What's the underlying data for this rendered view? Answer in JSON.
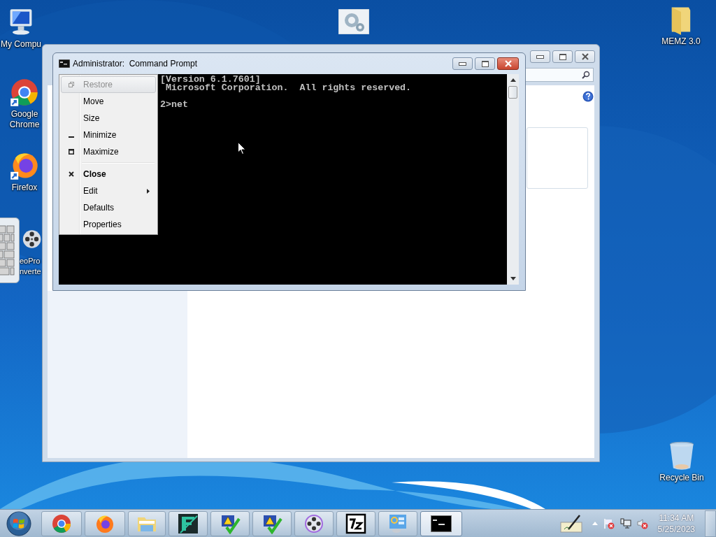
{
  "desktop_icons": [
    {
      "label": "My Compu"
    },
    {
      "label": "Google Chrome"
    },
    {
      "label": "Firefox"
    },
    {
      "label": "eoPro\nnverte"
    },
    {
      "label": "MEMZ 3.0"
    },
    {
      "label": "Recycle Bin"
    }
  ],
  "command_prompt": {
    "title": "Administrator:  Command Prompt",
    "lines": [
      {
        "kind": "text",
        "text": "[Version 6.1.7601]"
      },
      {
        "kind": "text",
        "text": " Microsoft Corporation.  All rights reserved."
      },
      {
        "kind": "blank"
      },
      {
        "kind": "text",
        "text": "2>net"
      }
    ]
  },
  "system_menu": [
    {
      "kind": "item",
      "label": "Restore",
      "disabled": true,
      "selected": true,
      "default": false,
      "submenu": false
    },
    {
      "kind": "item",
      "label": "Move",
      "disabled": false,
      "selected": false,
      "default": false,
      "submenu": false
    },
    {
      "kind": "item",
      "label": "Size",
      "disabled": false,
      "selected": false,
      "default": false,
      "submenu": false
    },
    {
      "kind": "item",
      "label": "Minimize",
      "disabled": false,
      "selected": false,
      "default": false,
      "submenu": false
    },
    {
      "kind": "item",
      "label": "Maximize",
      "disabled": false,
      "selected": false,
      "default": false,
      "submenu": false
    },
    {
      "kind": "separator"
    },
    {
      "kind": "item",
      "label": "Close",
      "disabled": false,
      "selected": false,
      "default": true,
      "submenu": false
    },
    {
      "kind": "item",
      "label": "Edit",
      "disabled": false,
      "selected": false,
      "default": false,
      "submenu": true
    },
    {
      "kind": "item",
      "label": "Defaults",
      "disabled": false,
      "selected": false,
      "default": false,
      "submenu": false
    },
    {
      "kind": "item",
      "label": "Properties",
      "disabled": false,
      "selected": false,
      "default": false,
      "submenu": false
    }
  ],
  "taskbar": {
    "items": [
      {
        "selected": false
      },
      {
        "selected": false
      },
      {
        "selected": false
      },
      {
        "selected": false
      },
      {
        "selected": false
      },
      {
        "selected": false
      },
      {
        "selected": false
      },
      {
        "selected": false
      },
      {
        "selected": false
      },
      {
        "selected": true
      }
    ],
    "clock": {
      "time": "11:34 AM",
      "date": "5/25/2023"
    }
  }
}
